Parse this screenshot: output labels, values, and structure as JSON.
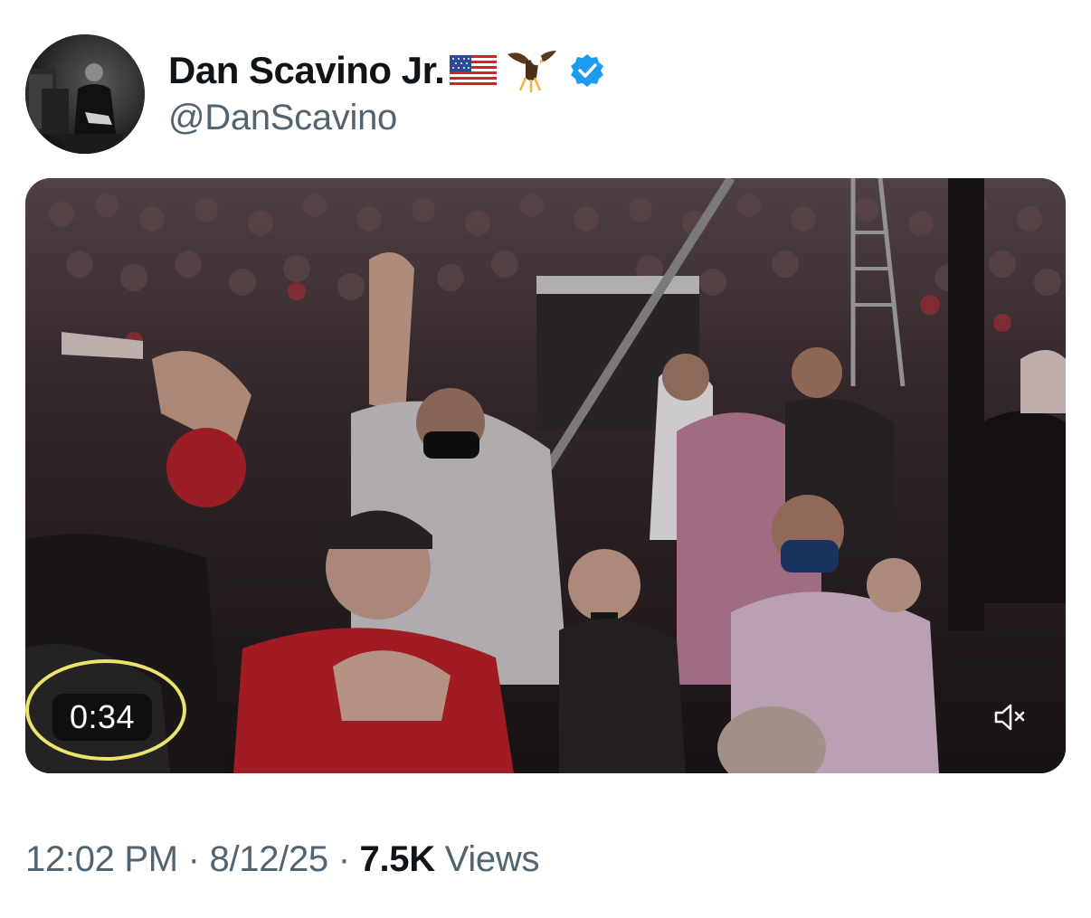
{
  "tweet": {
    "author": {
      "display_name": "Dan Scavino Jr.",
      "handle": "@DanScavino",
      "emojis": [
        "us-flag",
        "eagle"
      ],
      "verified": true,
      "verified_color": "#1d9bf0"
    },
    "media": {
      "type": "video",
      "duration": "0:34",
      "muted": true,
      "annotation_color": "#ece36a"
    },
    "meta": {
      "time": "12:02 PM",
      "separator": "·",
      "date": "8/12/25",
      "views_count": "7.5K",
      "views_label": "Views"
    }
  }
}
